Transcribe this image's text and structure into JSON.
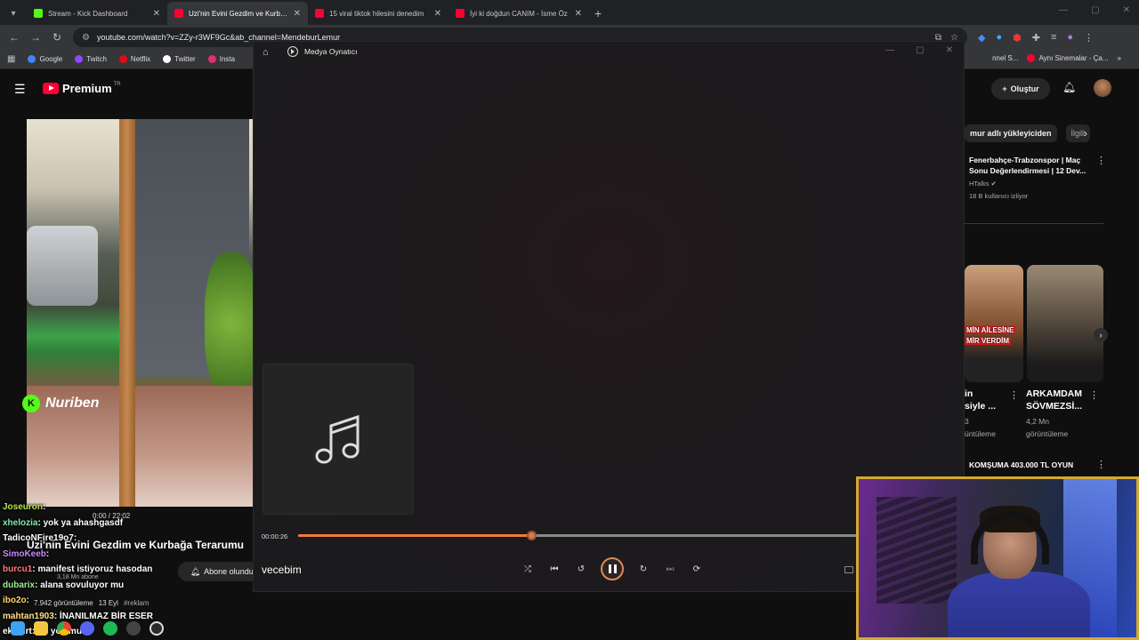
{
  "browser": {
    "tabs": [
      {
        "title": "Stream - Kick Dashboard",
        "color": "#53fc18",
        "active": false
      },
      {
        "title": "Uzi'nin Evini Gezdim ve Kurbağ",
        "color": "#ff0033",
        "active": true
      },
      {
        "title": "15 viral tiktok hilesini denedim",
        "color": "#ff0033",
        "active": false
      },
      {
        "title": "İyi ki doğdun CANIM - İsme Öz",
        "color": "#ff0033",
        "active": false
      }
    ],
    "url": "youtube.com/watch?v=ZZy-r3WF9Gc&ab_channel=MendeburLemur",
    "bookmarks": [
      {
        "label": "Google",
        "color": "#4285f4"
      },
      {
        "label": "Twitch",
        "color": "#9146ff"
      },
      {
        "label": "Netflix",
        "color": "#e50914"
      },
      {
        "label": "Twitter",
        "color": "#ffffff"
      },
      {
        "label": "Insta",
        "color": "#e1306c"
      }
    ],
    "bookmarks_right": [
      "nnel S...",
      "Aynı Sinemalar - Ça..."
    ]
  },
  "youtube": {
    "logo": "Premium",
    "logo_sup": "TR",
    "create_label": "Oluştur",
    "video_overlay_brand": "Nuriben",
    "video_time": "0:00 / 22:02",
    "video_title": "Uzi'nin Evini Gezdim ve Kurbağa Terarumu",
    "subscribed_label": "Abone olundu",
    "channel_subs": "3,18 Mn abone",
    "views": "7.942 görüntüleme",
    "date": "13 Eyl",
    "hashtag": "#reklam",
    "chips": [
      "mur adlı yükleyiciden",
      "İlgili"
    ],
    "rec1": {
      "title": "Fenerbahçe-Trabzonspor | Maç Sonu Değerlendirmesi | 12 Dev...",
      "channel": "HTalks",
      "meta": "18 B kullanıcı izliyor"
    },
    "short1_overlay_line1": "MİN AİLESİNE",
    "short1_overlay_line2": "MİR VERDİM",
    "short1_title": "in\nsiyle ...",
    "short1_meta": "3\nüntüleme",
    "short2_title": "ARKAMDAM\nSÖVMEZSİ...",
    "short2_meta": "4,2 Mn\ngörüntüleme",
    "rec3_title": "KOMŞUMA 403.000 TL OYUN"
  },
  "player": {
    "app_title": "Medya Oynatıcı",
    "time_elapsed": "00:00:26",
    "progress_fraction": 0.41,
    "song_title": "vecebim",
    "accent": "#f07a3c"
  },
  "chat": [
    {
      "user": "Joseuron",
      "msg": ": ",
      "color": "#b6e34a"
    },
    {
      "user": "xhelozia",
      "msg": ": yok ya ahashgasdf",
      "color": "#7ff0a8"
    },
    {
      "user": "TadicoNFire19o7",
      "msg": ": ",
      "color": "#ffffff"
    },
    {
      "user": "SimoKeeb",
      "msg": ": ",
      "color": "#c58bff"
    },
    {
      "user": "burcu1",
      "msg": ": manifest istiyoruz hasodan",
      "color": "#ff7a7a"
    },
    {
      "user": "dubarix",
      "msg": ": alana sovuluyor mu",
      "color": "#9ef08a"
    },
    {
      "user": "ibo2o",
      "msg": ": ",
      "color": "#ffd76b"
    },
    {
      "user": "mahtan1903",
      "msg": ": İNANILMAZ BİR ESER",
      "color": "#ffe08a"
    },
    {
      "user": "eksmrt",
      "msg": ": fm yok mu",
      "color": "#ffffff"
    }
  ]
}
